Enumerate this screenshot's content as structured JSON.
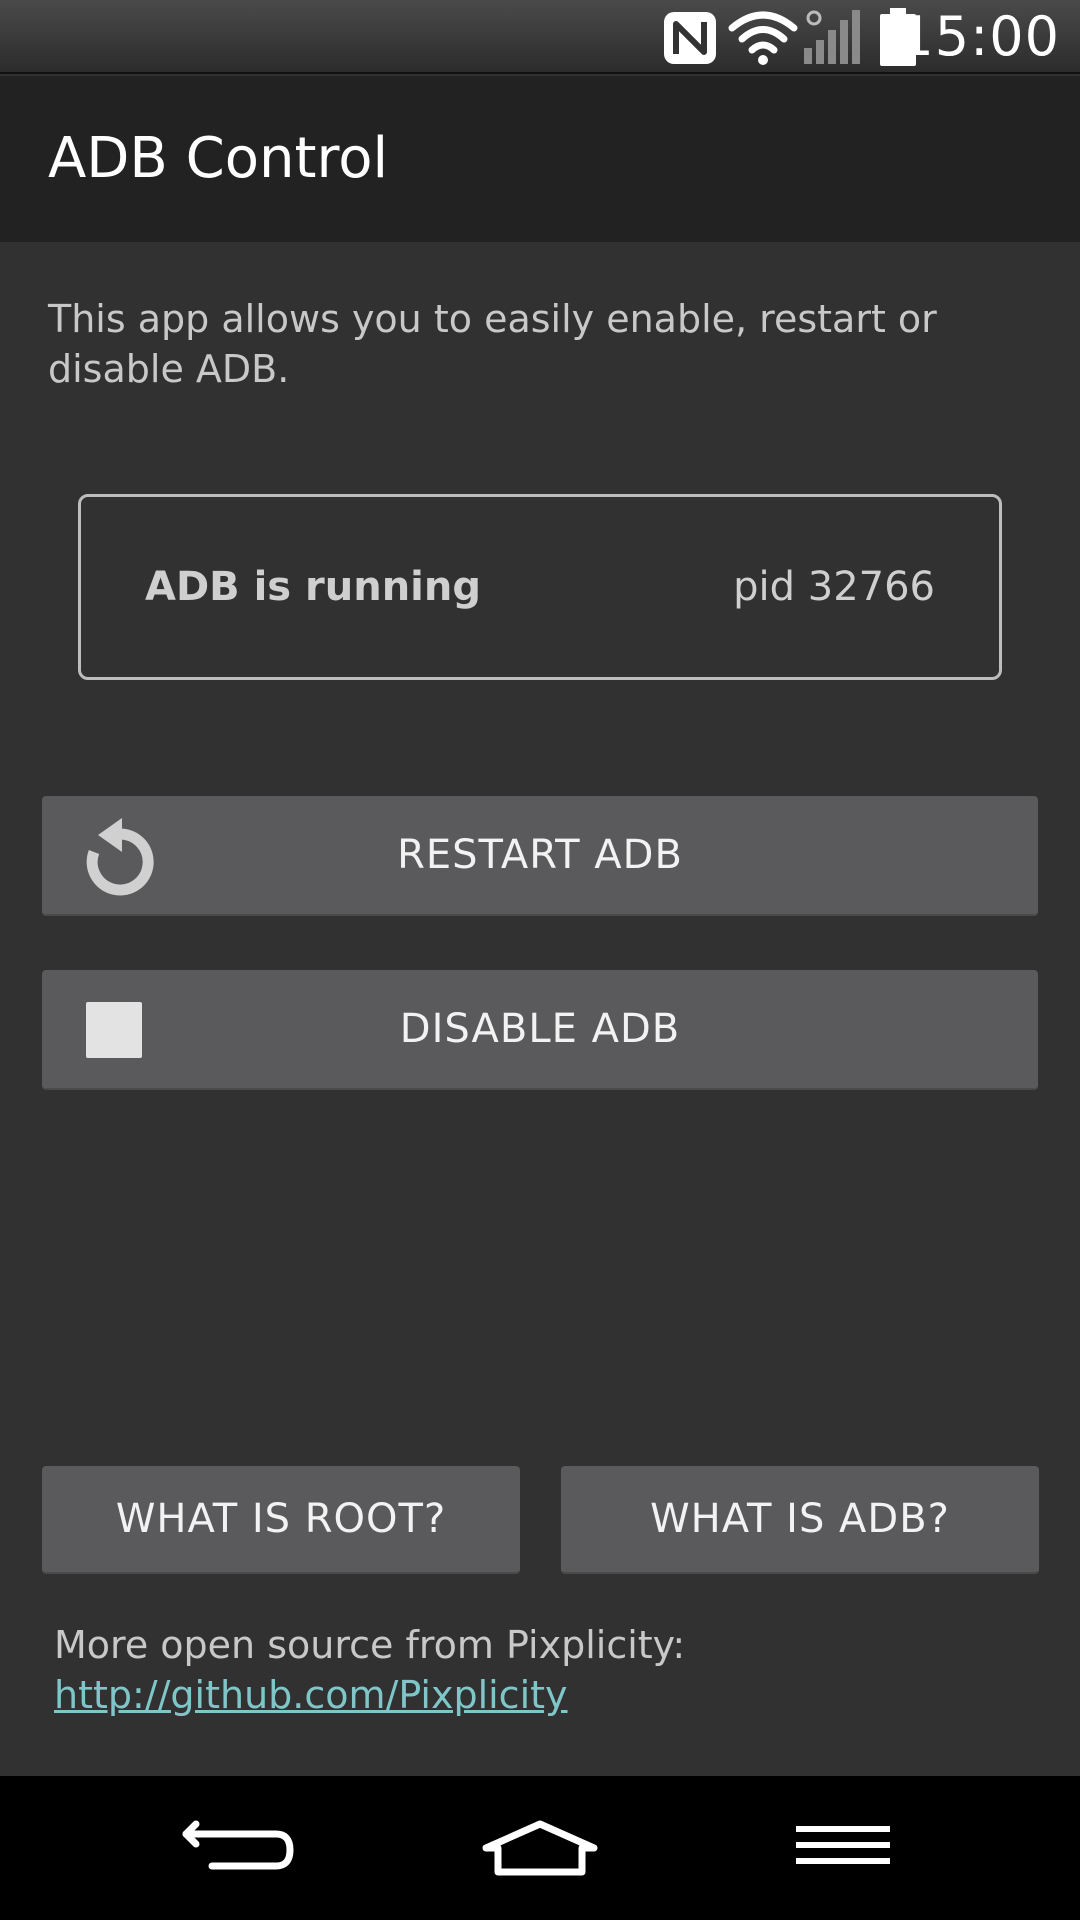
{
  "status_bar": {
    "time": "15:00",
    "icons": [
      "nfc-icon",
      "wifi-icon",
      "signal-icon",
      "battery-icon"
    ]
  },
  "app": {
    "title": "ADB Control"
  },
  "main": {
    "description": "This app allows you to easily enable, restart or disable ADB.",
    "status": {
      "text": "ADB is running",
      "pid": "pid 32766"
    },
    "restart_button": {
      "label": "RESTART ADB",
      "icon": "restart-icon"
    },
    "disable_button": {
      "label": "DISABLE ADB",
      "icon": "stop-icon"
    },
    "root_button": {
      "label": "WHAT IS ROOT?"
    },
    "adb_button": {
      "label": "WHAT IS ADB?"
    },
    "footer": {
      "text": "More open source from Pixplicity:",
      "link": "http://github.com/Pixplicity"
    }
  },
  "nav_bar": {
    "icons": [
      "back-icon",
      "home-icon",
      "menu-icon"
    ]
  },
  "colors": {
    "background": "#313131",
    "action_bar": "#222222",
    "button": "#5a5a5c",
    "link": "#7fc6c9"
  }
}
